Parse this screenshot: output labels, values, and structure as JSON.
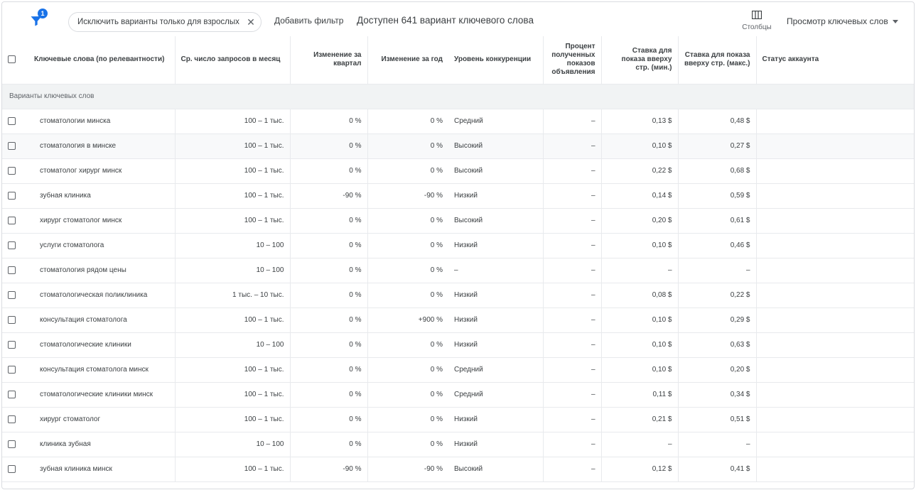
{
  "toolbar": {
    "filter_count": "1",
    "chip_label": "Исключить варианты только для взрослых",
    "chip_close": "✕",
    "add_filter": "Добавить фильтр",
    "available": "Доступен 641 вариант ключевого слова",
    "columns_label": "Столбцы",
    "view_label": "Просмотр ключевых слов"
  },
  "columns": {
    "keyword": "Ключевые слова (по релевантности)",
    "avg_searches": "Ср. число запросов в месяц",
    "change_quarter": "Изменение за квартал",
    "change_year": "Изменение за год",
    "competition": "Уровень конкуренции",
    "impression_share": "Процент полученных показов объявления",
    "bid_low": "Ставка для показа вверху стр. (мин.)",
    "bid_high": "Ставка для показа вверху стр. (макс.)",
    "account_status": "Статус аккаунта"
  },
  "group_label": "Варианты ключевых слов",
  "rows": [
    {
      "keyword": "стоматологии минска",
      "searches": "100 – 1 тыс.",
      "quarter": "0 %",
      "year": "0 %",
      "competition": "Средний",
      "share": "–",
      "low": "0,13 $",
      "high": "0,48 $"
    },
    {
      "keyword": "стоматология в минске",
      "searches": "100 – 1 тыс.",
      "quarter": "0 %",
      "year": "0 %",
      "competition": "Высокий",
      "share": "–",
      "low": "0,10 $",
      "high": "0,27 $"
    },
    {
      "keyword": "стоматолог хирург минск",
      "searches": "100 – 1 тыс.",
      "quarter": "0 %",
      "year": "0 %",
      "competition": "Высокий",
      "share": "–",
      "low": "0,22 $",
      "high": "0,68 $"
    },
    {
      "keyword": "зубная клиника",
      "searches": "100 – 1 тыс.",
      "quarter": "-90 %",
      "year": "-90 %",
      "competition": "Низкий",
      "share": "–",
      "low": "0,14 $",
      "high": "0,59 $"
    },
    {
      "keyword": "хирург стоматолог минск",
      "searches": "100 – 1 тыс.",
      "quarter": "0 %",
      "year": "0 %",
      "competition": "Высокий",
      "share": "–",
      "low": "0,20 $",
      "high": "0,61 $"
    },
    {
      "keyword": "услуги стоматолога",
      "searches": "10 – 100",
      "quarter": "0 %",
      "year": "0 %",
      "competition": "Низкий",
      "share": "–",
      "low": "0,10 $",
      "high": "0,46 $"
    },
    {
      "keyword": "стоматология рядом цены",
      "searches": "10 – 100",
      "quarter": "0 %",
      "year": "0 %",
      "competition": "–",
      "share": "–",
      "low": "–",
      "high": "–"
    },
    {
      "keyword": "стоматологическая поликлиника",
      "searches": "1 тыс. – 10 тыс.",
      "quarter": "0 %",
      "year": "0 %",
      "competition": "Низкий",
      "share": "–",
      "low": "0,08 $",
      "high": "0,22 $"
    },
    {
      "keyword": "консультация стоматолога",
      "searches": "100 – 1 тыс.",
      "quarter": "0 %",
      "year": "+900 %",
      "competition": "Низкий",
      "share": "–",
      "low": "0,10 $",
      "high": "0,29 $"
    },
    {
      "keyword": "стоматологические клиники",
      "searches": "10 – 100",
      "quarter": "0 %",
      "year": "0 %",
      "competition": "Низкий",
      "share": "–",
      "low": "0,10 $",
      "high": "0,63 $"
    },
    {
      "keyword": "консультация стоматолога минск",
      "searches": "100 – 1 тыс.",
      "quarter": "0 %",
      "year": "0 %",
      "competition": "Средний",
      "share": "–",
      "low": "0,10 $",
      "high": "0,20 $"
    },
    {
      "keyword": "стоматологические клиники минск",
      "searches": "100 – 1 тыс.",
      "quarter": "0 %",
      "year": "0 %",
      "competition": "Средний",
      "share": "–",
      "low": "0,11 $",
      "high": "0,34 $"
    },
    {
      "keyword": "хирург стоматолог",
      "searches": "100 – 1 тыс.",
      "quarter": "0 %",
      "year": "0 %",
      "competition": "Низкий",
      "share": "–",
      "low": "0,21 $",
      "high": "0,51 $"
    },
    {
      "keyword": "клиника зубная",
      "searches": "10 – 100",
      "quarter": "0 %",
      "year": "0 %",
      "competition": "Низкий",
      "share": "–",
      "low": "–",
      "high": "–"
    },
    {
      "keyword": "зубная клиника минск",
      "searches": "100 – 1 тыс.",
      "quarter": "-90 %",
      "year": "-90 %",
      "competition": "Высокий",
      "share": "–",
      "low": "0,12 $",
      "high": "0,41 $"
    }
  ]
}
